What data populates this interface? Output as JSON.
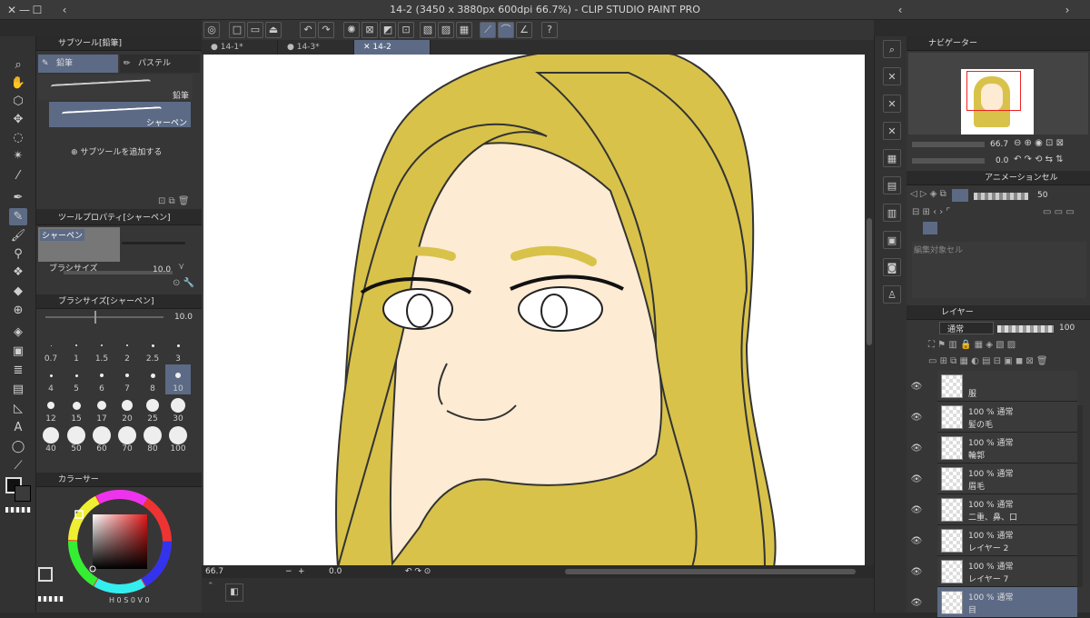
{
  "window": {
    "title": "14-2 (3450 x 3880px 600dpi 66.7%) - CLIP STUDIO PAINT PRO"
  },
  "doc_tabs": [
    "14-1*",
    "14-3*",
    "14-2"
  ],
  "subtool_panel": {
    "title": "サブツール[鉛筆]",
    "tabs": [
      "鉛筆",
      "パステル"
    ],
    "brushes": [
      "鉛筆",
      "シャーペン"
    ],
    "add_label": "サブツールを追加する"
  },
  "tool_property": {
    "title": "ツールプロパティ[シャーペン]",
    "preview_label": "シャーペン",
    "brush_size_label": "ブラシサイズ",
    "brush_size_value": "10.0"
  },
  "brush_size_panel": {
    "title": "ブラシサイズ[シャーペン]",
    "value": "10.0",
    "sizes": [
      "0.7",
      "1",
      "1.5",
      "2",
      "2.5",
      "3",
      "4",
      "5",
      "6",
      "7",
      "8",
      "10",
      "12",
      "15",
      "17",
      "20",
      "25",
      "30",
      "40",
      "50",
      "60",
      "70",
      "80",
      "100"
    ],
    "selected": "10"
  },
  "color_panel": {
    "title": "カラーサー",
    "readout": "H 0  S 0  V 0",
    "main_color": "#111111",
    "sub_color": "#ffffff"
  },
  "navigator": {
    "title": "ナビゲーター",
    "zoom": "66.7",
    "rotation": "0.0"
  },
  "animation": {
    "title": "アニメーションセル",
    "value": "50",
    "edit_cell_label": "編集対象セル"
  },
  "layers": {
    "title": "レイヤー",
    "blend_mode": "通常",
    "opacity": "100",
    "items": [
      {
        "meta": "",
        "name": "服"
      },
      {
        "meta": "100 % 通常",
        "name": "髪の毛"
      },
      {
        "meta": "100 % 通常",
        "name": "輪郭"
      },
      {
        "meta": "100 % 通常",
        "name": "眉毛"
      },
      {
        "meta": "100 % 通常",
        "name": "二重、鼻、口"
      },
      {
        "meta": "100 % 通常",
        "name": "レイヤー 2"
      },
      {
        "meta": "100 % 通常",
        "name": "レイヤー 7"
      },
      {
        "meta": "100 % 通常",
        "name": "目"
      }
    ]
  },
  "status": {
    "zoom": "66.7",
    "angle": "0.0"
  },
  "colors": {
    "hair": "#d8c24a",
    "skin": "#fdebd3",
    "accent": "#5c6a85"
  }
}
